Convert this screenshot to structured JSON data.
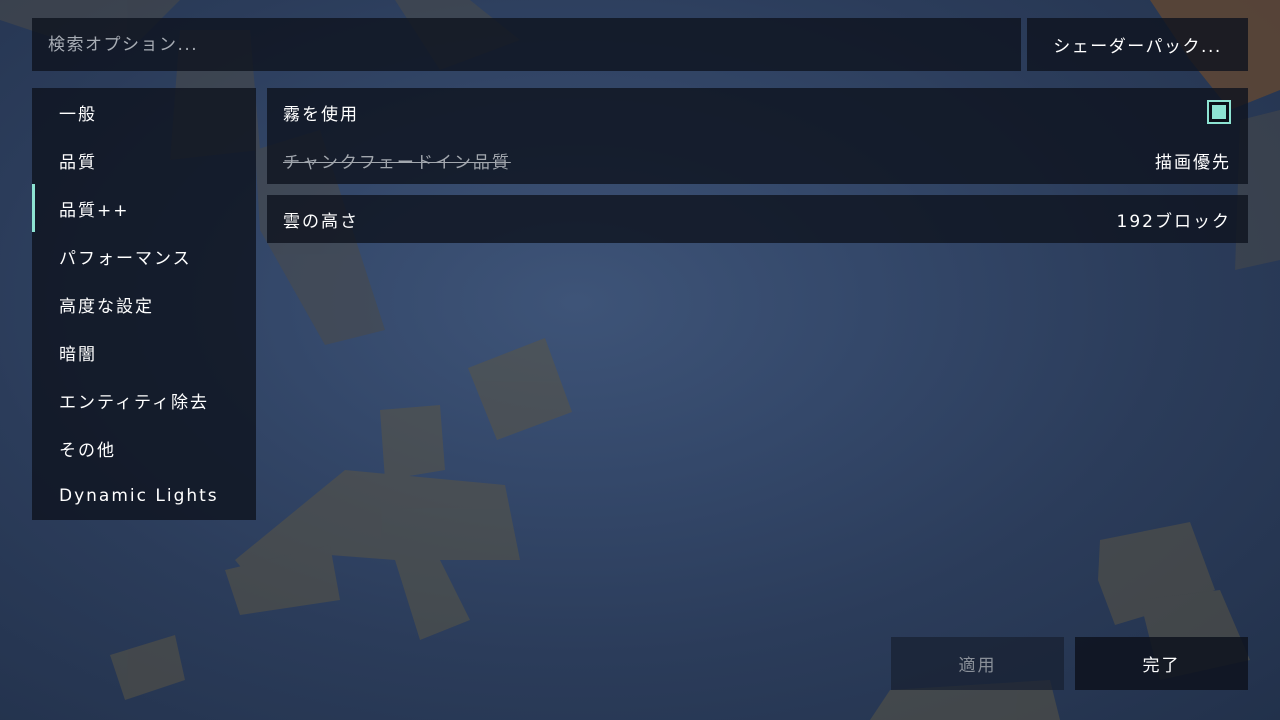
{
  "search": {
    "placeholder": "検索オプション...",
    "value": ""
  },
  "shader_button": {
    "label": "シェーダーパック..."
  },
  "sidebar": {
    "selected": "品質++",
    "items": [
      {
        "label": "一般"
      },
      {
        "label": "品質"
      },
      {
        "label": "品質++"
      },
      {
        "label": "パフォーマンス"
      },
      {
        "label": "高度な設定"
      },
      {
        "label": "暗闇"
      },
      {
        "label": "エンティティ除去"
      },
      {
        "label": "その他"
      },
      {
        "label": "Dynamic Lights"
      }
    ]
  },
  "options": {
    "fog": {
      "label": "霧を使用",
      "checked": true
    },
    "chunk_fade": {
      "label": "チャンクフェードイン品質",
      "value": "描画優先",
      "disabled": true
    },
    "cloud_height": {
      "label": "雲の高さ",
      "value": "192ブロック"
    }
  },
  "footer": {
    "apply_label": "適用",
    "done_label": "完了"
  },
  "colors": {
    "accent": "#8de3d2",
    "panel": "#0e131e",
    "background": "#2f4262"
  }
}
